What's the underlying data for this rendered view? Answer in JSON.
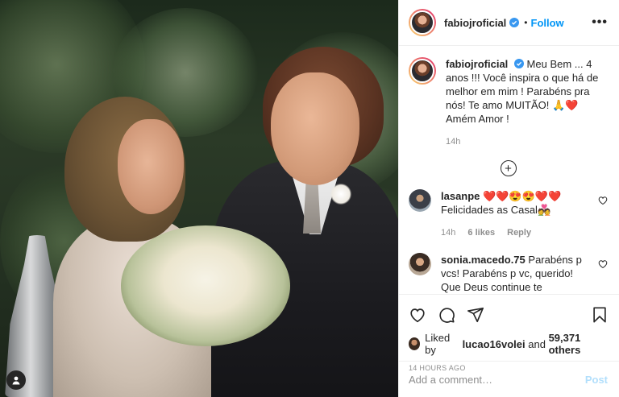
{
  "post": {
    "author": {
      "username": "fabiojroficial",
      "follow_label": "Follow",
      "separator": "•",
      "more_label": "•••"
    },
    "caption": {
      "username": "fabiojroficial",
      "text": "Meu Bem ... 4 anos !!! Você inspira o que há de melhor em mim ! Parabéns pra nós! Te amo MUITÃO! ",
      "emoji": "🙏❤️",
      "tail": "Amém Amor !",
      "time": "14h"
    },
    "load_more": "+",
    "comments": [
      {
        "username": "lasanpe",
        "hearts": "❤️❤️😍😍❤️❤️",
        "text": "Felicidades as Casal",
        "emoji": "💑",
        "time": "14h",
        "likes": "6 likes",
        "reply": "Reply"
      },
      {
        "username": "sonia.macedo.75",
        "text": "Parabéns p vcs! Parabéns p vc, querido! Que Deus continue te abençoando cada dia mais! Muita luz p sua"
      }
    ],
    "likes": {
      "prefix": "Liked by",
      "user": "lucao16volei",
      "and": "and",
      "others": "59,371 others"
    },
    "timestamp": "14 HOURS AGO",
    "comment_box": {
      "placeholder": "Add a comment…",
      "post_label": "Post"
    }
  },
  "colors": {
    "accent": "#0095f6",
    "post_disabled": "#b2dffc",
    "muted": "#8e8e8e",
    "heart": "#ed4956"
  },
  "icons": [
    "user-tag-icon",
    "verified-badge-icon",
    "more-options-icon",
    "heart-icon",
    "comment-icon",
    "share-icon",
    "bookmark-icon",
    "add-comments-icon"
  ]
}
